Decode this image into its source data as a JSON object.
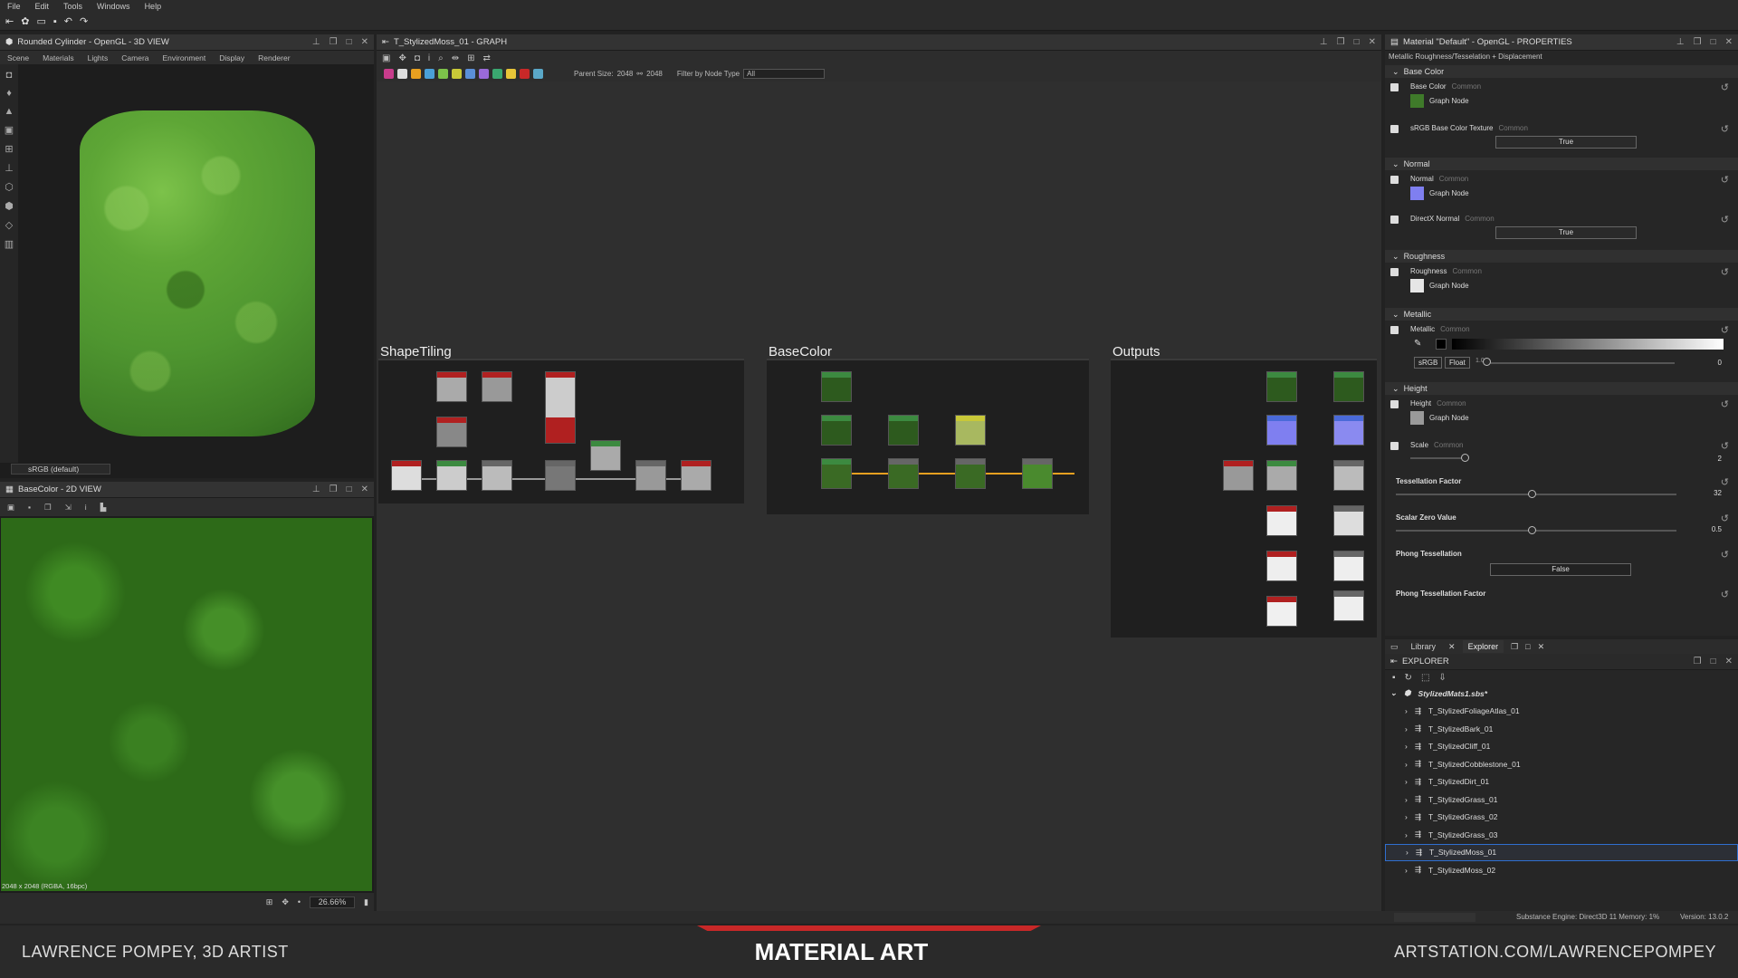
{
  "menu": [
    "File",
    "Edit",
    "Tools",
    "Windows",
    "Help"
  ],
  "view3d": {
    "title": "Rounded Cylinder - OpenGL - 3D VIEW",
    "menu": [
      "Scene",
      "Materials",
      "Lights",
      "Camera",
      "Environment",
      "Display",
      "Renderer"
    ],
    "colorspace": "sRGB (default)"
  },
  "view2d": {
    "title": "BaseColor - 2D VIEW",
    "resolution": "2048 x 2048 (RGBA, 16bpc)",
    "zoom": "26.66%"
  },
  "graph": {
    "title": "T_StylizedMoss_01 - GRAPH",
    "parent_size_label": "Parent Size:",
    "parent_size": "2048",
    "size2": "2048",
    "filter_label": "Filter by Node Type",
    "filter_value": "All",
    "frames": [
      "ShapeTiling",
      "BaseColor",
      "Outputs"
    ]
  },
  "properties": {
    "title": "Material \"Default\" - OpenGL - PROPERTIES",
    "subtitle": "Metallic Roughness/Tesselation + Displacement",
    "sections": {
      "base_color": "Base Color",
      "normal": "Normal",
      "roughness": "Roughness",
      "metallic": "Metallic",
      "height": "Height"
    },
    "common": "Common",
    "graph_node": "Graph Node",
    "base_color_label": "Base Color",
    "srgb_texture_label": "sRGB Base Color Texture",
    "srgb_texture_value": "True",
    "normal_label": "Normal",
    "directx_label": "DirectX Normal",
    "directx_value": "True",
    "roughness_label": "Roughness",
    "metallic_label": "Metallic",
    "metallic_btn1": "sRGB",
    "metallic_btn2": "Float",
    "metallic_mark": "1.0",
    "metallic_value": "0",
    "height_label": "Height",
    "scale_label": "Scale",
    "scale_value": "2",
    "tess_label": "Tessellation Factor",
    "tess_value": "32",
    "szv_label": "Scalar Zero Value",
    "szv_value": "0.5",
    "phong_label": "Phong Tessellation",
    "phong_value": "False",
    "phong_factor_label": "Phong Tessellation Factor",
    "colors": {
      "base": "#3f7a2a",
      "normal": "#7f7ff0",
      "rough": "#e6e6e6",
      "height": "#9a9a9a"
    }
  },
  "explorer": {
    "tabs": [
      "Library",
      "Explorer"
    ],
    "header": "EXPLORER",
    "package": "StylizedMats1.sbs*",
    "items": [
      "T_StylizedFoliageAtlas_01",
      "T_StylizedBark_01",
      "T_StylizedCliff_01",
      "T_StylizedCobblestone_01",
      "T_StylizedDirt_01",
      "T_StylizedGrass_01",
      "T_StylizedGrass_02",
      "T_StylizedGrass_03",
      "T_StylizedMoss_01",
      "T_StylizedMoss_02"
    ],
    "selected": 8
  },
  "status": {
    "engine": "Substance Engine: Direct3D 11  Memory: 1%",
    "version": "Version: 13.0.2"
  },
  "banner": {
    "left": "LAWRENCE POMPEY, 3D ARTIST",
    "center": "MATERIAL ART",
    "right": "ARTSTATION.COM/LAWRENCEPOMPEY"
  }
}
